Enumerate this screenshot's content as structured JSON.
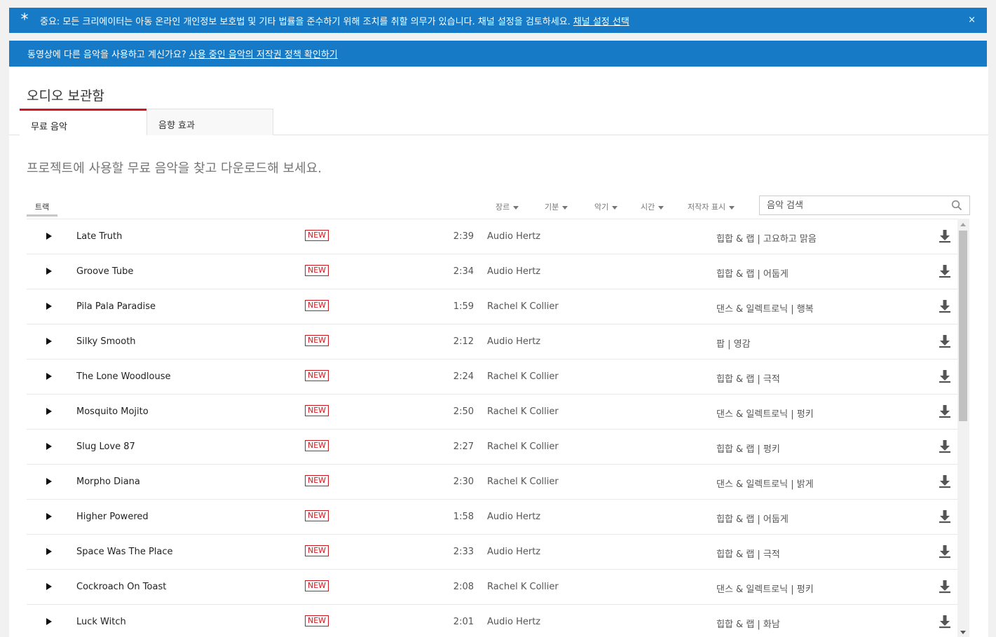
{
  "notice": {
    "text": "중요: 모든 크리에이터는 아동 온라인 개인정보 보호법 및 기타 법률을 준수하기 위해 조치를 취할 의무가 있습니다. 채널 설정을 검토하세요.",
    "link": "채널 설정 선택",
    "close": "×"
  },
  "music_banner": {
    "text": "동영상에 다른 음악을 사용하고 계신가요?",
    "link": "사용 중인 음악의 저작권 정책 확인하기"
  },
  "panel_title": "오디오 보관함",
  "tabs": [
    "무료 음악",
    "음향 효과"
  ],
  "intro": "프로젝트에 사용할 무료 음악을 찾고 다운로드해 보세요.",
  "tracks_tab": "트랙",
  "filters": [
    "장르",
    "기분",
    "악기",
    "시간",
    "저작자 표시"
  ],
  "search": {
    "placeholder": "음악 검색"
  },
  "tracks": [
    {
      "title": "Late Truth",
      "badge": "NEW",
      "duration": "2:39",
      "artist": "Audio Hertz",
      "genre": "힙합 & 랩 | 고요하고 맑음"
    },
    {
      "title": "Groove Tube",
      "badge": "NEW",
      "duration": "2:34",
      "artist": "Audio Hertz",
      "genre": "힙합 & 랩 | 어둡게"
    },
    {
      "title": "Pila Pala Paradise",
      "badge": "NEW",
      "duration": "1:59",
      "artist": "Rachel K Collier",
      "genre": "댄스 & 일렉트로닉 | 행복"
    },
    {
      "title": "Silky Smooth",
      "badge": "NEW",
      "duration": "2:12",
      "artist": "Audio Hertz",
      "genre": "팝 | 영감"
    },
    {
      "title": "The Lone Woodlouse",
      "badge": "NEW",
      "duration": "2:24",
      "artist": "Rachel K Collier",
      "genre": "힙합 & 랩 | 극적"
    },
    {
      "title": "Mosquito Mojito",
      "badge": "NEW",
      "duration": "2:50",
      "artist": "Rachel K Collier",
      "genre": "댄스 & 일렉트로닉 | 펑키"
    },
    {
      "title": "Slug Love 87",
      "badge": "NEW",
      "duration": "2:27",
      "artist": "Rachel K Collier",
      "genre": "힙합 & 랩 | 펑키"
    },
    {
      "title": "Morpho Diana",
      "badge": "NEW",
      "duration": "2:30",
      "artist": "Rachel K Collier",
      "genre": "댄스 & 일렉트로닉 | 밝게"
    },
    {
      "title": "Higher Powered",
      "badge": "NEW",
      "duration": "1:58",
      "artist": "Audio Hertz",
      "genre": "힙합 & 랩 | 어둡게"
    },
    {
      "title": "Space Was The Place",
      "badge": "NEW",
      "duration": "2:33",
      "artist": "Audio Hertz",
      "genre": "힙합 & 랩 | 극적"
    },
    {
      "title": "Cockroach On Toast",
      "badge": "NEW",
      "duration": "2:08",
      "artist": "Rachel K Collier",
      "genre": "댄스 & 일렉트로닉 | 펑키"
    },
    {
      "title": "Luck Witch",
      "badge": "NEW",
      "duration": "2:01",
      "artist": "Audio Hertz",
      "genre": "힙합 & 랩 | 화남"
    }
  ],
  "colors": {
    "banner": "#167ac6",
    "accent_red": "#cc181e"
  }
}
